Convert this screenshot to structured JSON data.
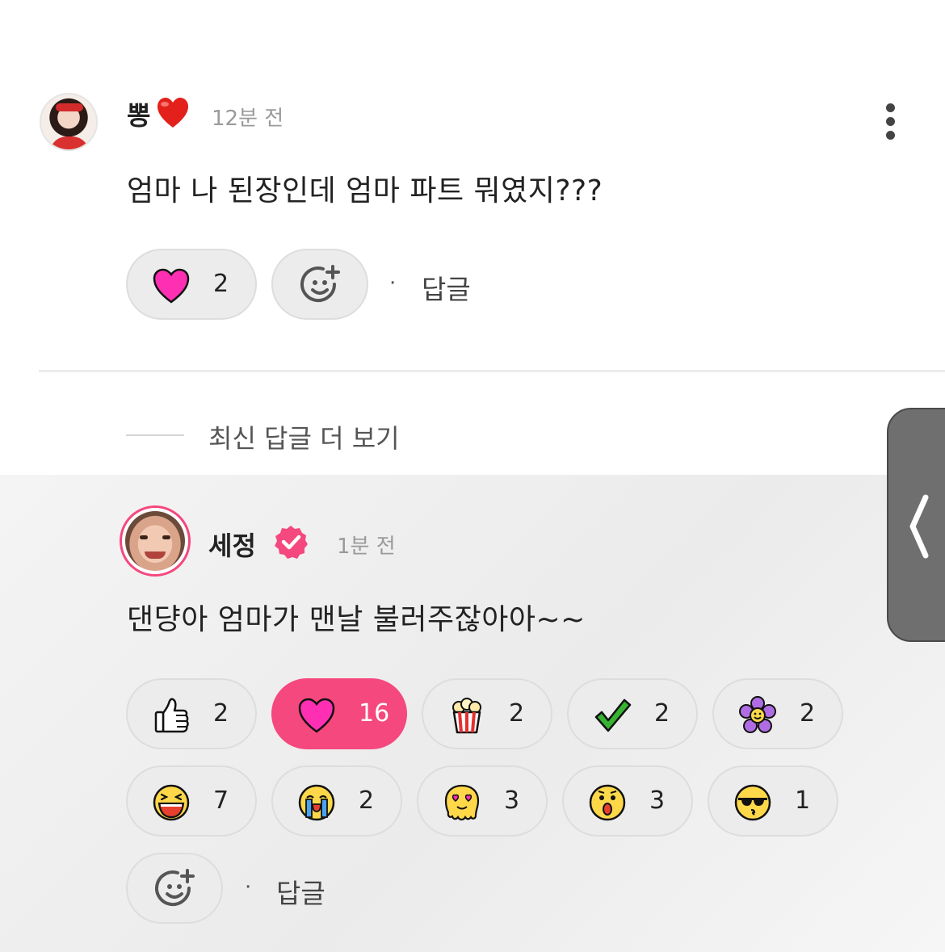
{
  "comments": [
    {
      "author": "뽕",
      "author_emoji": "heart-emoji",
      "time": "12분 전",
      "text": "엄마 나 된장인데 엄마 파트 뭐였지???",
      "reactions": [
        {
          "icon": "heart-icon",
          "count": "2"
        }
      ],
      "reply_label": "답글",
      "separator": "·"
    },
    {
      "author": "세정",
      "verified": true,
      "time": "1분 전",
      "text": "댄댱아 엄마가 맨날 불러주잖아아~~",
      "reactions": [
        {
          "icon": "thumbs-up-icon",
          "count": "2"
        },
        {
          "icon": "heart-icon",
          "count": "16",
          "selected": true
        },
        {
          "icon": "popcorn-icon",
          "count": "2"
        },
        {
          "icon": "check-icon",
          "count": "2"
        },
        {
          "icon": "flower-icon",
          "count": "2"
        },
        {
          "icon": "laughing-face-icon",
          "count": "7"
        },
        {
          "icon": "crying-face-icon",
          "count": "2"
        },
        {
          "icon": "heart-eyes-face-icon",
          "count": "3"
        },
        {
          "icon": "surprised-face-icon",
          "count": "3"
        },
        {
          "icon": "sunglasses-face-icon",
          "count": "1"
        }
      ],
      "reply_label": "답글",
      "separator": "·"
    }
  ],
  "more_replies_label": "최신 답글 더 보기",
  "colors": {
    "accent": "#f5487e",
    "heart": "#ff2fb3",
    "pill_bg": "#ececec"
  }
}
